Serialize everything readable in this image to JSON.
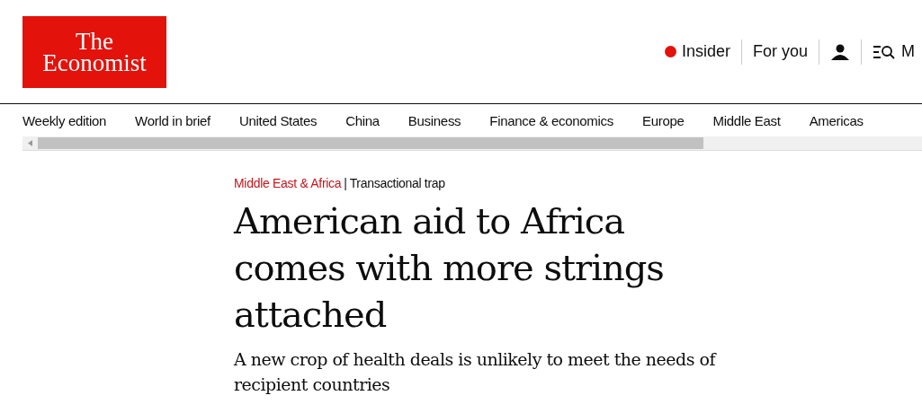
{
  "logo": {
    "line_1": "The",
    "line_2": "Economist"
  },
  "top_links": [
    {
      "kind": "insider",
      "label": "Insider"
    },
    {
      "kind": "text",
      "label": "For you"
    },
    {
      "kind": "account"
    },
    {
      "kind": "menu",
      "label": "M"
    }
  ],
  "nav": [
    "Weekly edition",
    "World in brief",
    "United States",
    "China",
    "Business",
    "Finance & economics",
    "Europe",
    "Middle East",
    "Americas"
  ],
  "article": {
    "section": "Middle East & Africa",
    "separator": "|",
    "rubric": "Transactional trap",
    "headline": "American aid to Africa comes with more strings attached",
    "standfirst": "A new crop of health deals is unlikely to meet the needs of recipient countries"
  }
}
